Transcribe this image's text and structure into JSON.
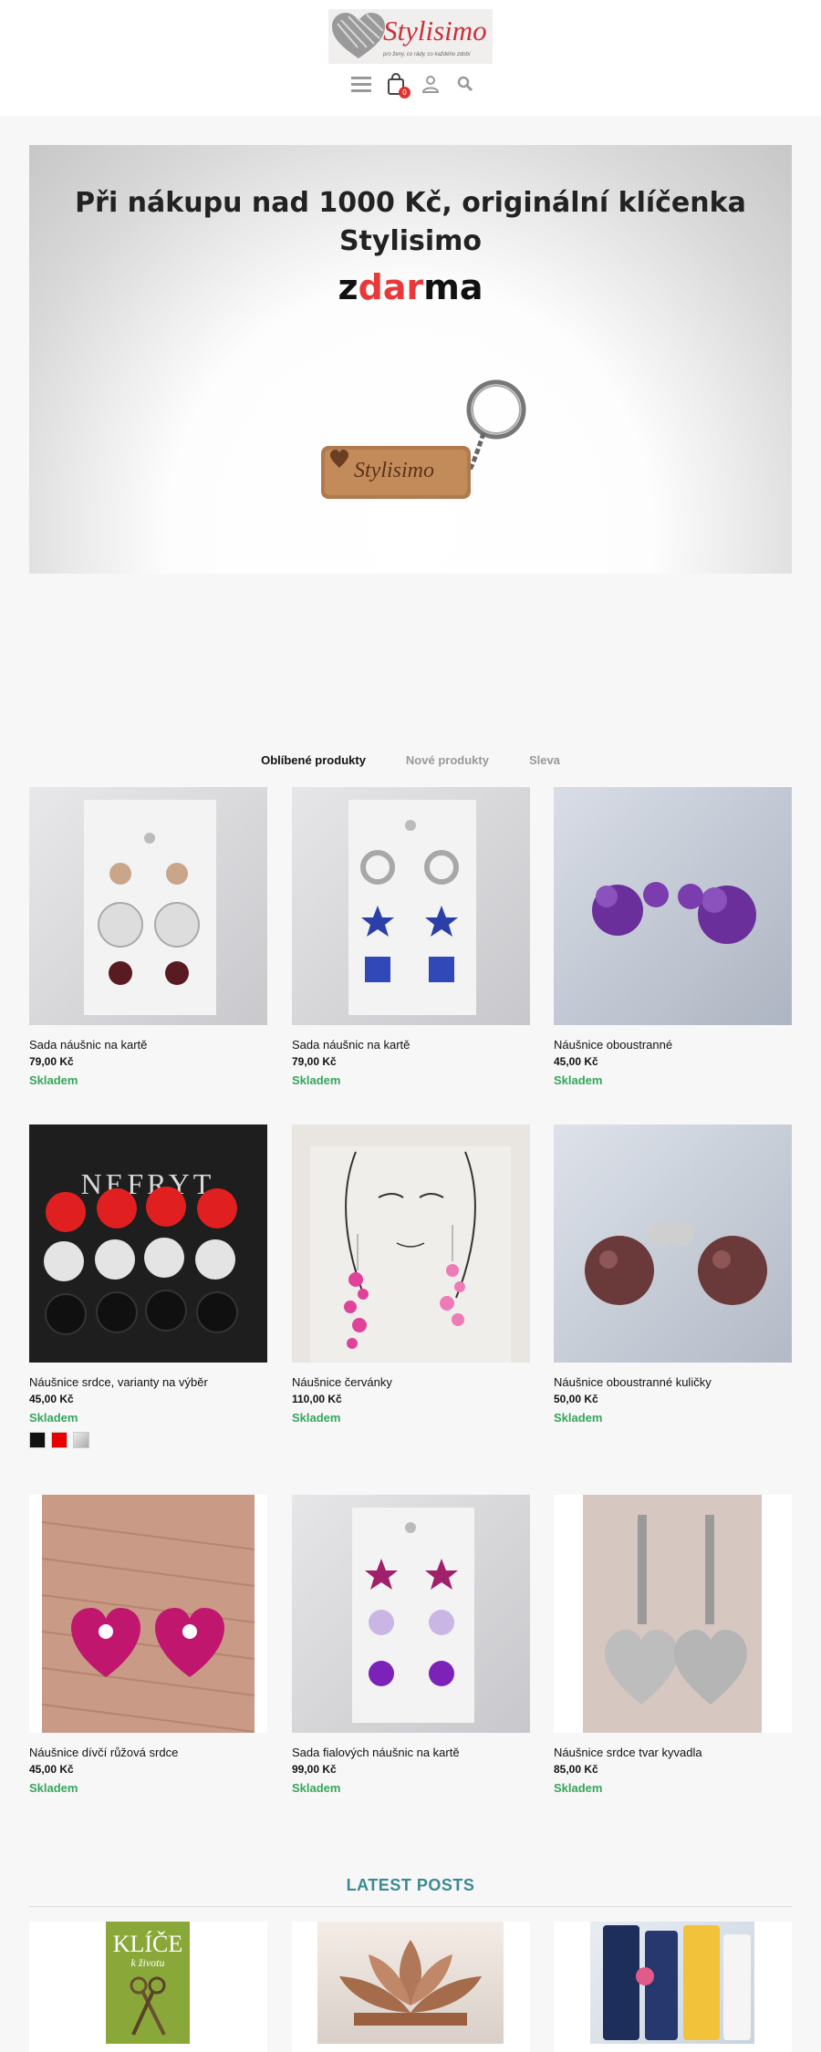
{
  "header": {
    "brand": "Stylisimo",
    "tagline": "pro ženy, co rády, co každého zdobí",
    "cart_count": "0",
    "icons": [
      "menu-icon",
      "shopping-bag-icon",
      "user-icon",
      "search-icon"
    ]
  },
  "banner": {
    "line1": "Při nákupu nad 1000 Kč, originální klíčenka",
    "line2": "Stylisimo",
    "line3_a": "z",
    "line3_b": "dar",
    "line3_c": "ma",
    "keychain_text": "Stylisimo"
  },
  "tabs": [
    {
      "label": "Oblíbené produkty",
      "active": true
    },
    {
      "label": "Nové produkty",
      "active": false
    },
    {
      "label": "Sleva",
      "active": false
    }
  ],
  "products": [
    {
      "name": "Sada náušnic na kartě",
      "price": "79,00 Kč",
      "stock": "Skladem"
    },
    {
      "name": "Sada náušnic na kartě",
      "price": "79,00 Kč",
      "stock": "Skladem"
    },
    {
      "name": "Náušnice oboustranné",
      "price": "45,00 Kč",
      "stock": "Skladem"
    },
    {
      "name": "Náušnice srdce, varianty na výběr",
      "price": "45,00 Kč",
      "stock": "Skladem"
    },
    {
      "name": "Náušnice červánky",
      "price": "110,00 Kč",
      "stock": "Skladem"
    },
    {
      "name": "Náušnice oboustranné kuličky",
      "price": "50,00 Kč",
      "stock": "Skladem"
    },
    {
      "name": "Náušnice dívčí růžová srdce",
      "price": "45,00 Kč",
      "stock": "Skladem"
    },
    {
      "name": "Sada fialových náušnic na kartě",
      "price": "99,00 Kč",
      "stock": "Skladem"
    },
    {
      "name": "Náušnice srdce tvar kyvadla",
      "price": "85,00 Kč",
      "stock": "Skladem"
    }
  ],
  "swatch_colors": [
    "#111111",
    "#e60000",
    "#c9c9c9"
  ],
  "card_brand": "NEFRYT",
  "posts": {
    "title": "LATEST POSTS",
    "book_title_1": "KLÍČE",
    "book_title_2": "k životu"
  },
  "colors": {
    "accent_teal": "#3a8a92",
    "stock_green": "#35a65b",
    "brand_red": "#c9303a"
  }
}
